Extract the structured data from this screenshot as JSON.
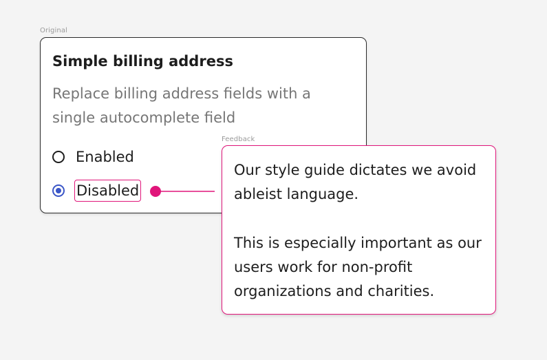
{
  "labels": {
    "original": "Original",
    "feedback": "Feedback"
  },
  "setting": {
    "title": "Simple billing address",
    "description": "Replace billing address fields with a single autocomplete field",
    "options": [
      {
        "label": "Enabled",
        "selected": false
      },
      {
        "label": "Disabled",
        "selected": true
      }
    ]
  },
  "feedback": {
    "paragraphs": [
      "Our style guide dictates we avoid ableist language.",
      "This is especially important as our users work for non-profit organizations and charities."
    ]
  },
  "colors": {
    "highlight": "#e0157a",
    "radio_selected": "#3a55c7"
  }
}
